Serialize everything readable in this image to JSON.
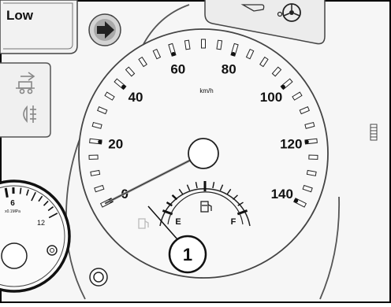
{
  "low_label": "Low",
  "speedometer": {
    "unit": "km/h",
    "scale_labels": [
      "0",
      "20",
      "40",
      "60",
      "80",
      "100",
      "120",
      "140"
    ],
    "needle_value": 0
  },
  "fuel_gauge": {
    "empty_label": "E",
    "full_label": "F"
  },
  "left_gauge": {
    "value_label": "6",
    "unit_label": "x0.1MPa",
    "max_label": "12"
  },
  "callout": {
    "number": "1"
  },
  "icons": [
    "right-arrow-indicator-icon",
    "trailer-icon",
    "rear-fog-icon",
    "fuel-pump-icon",
    "steering-icon",
    "round-knob-icon"
  ]
}
